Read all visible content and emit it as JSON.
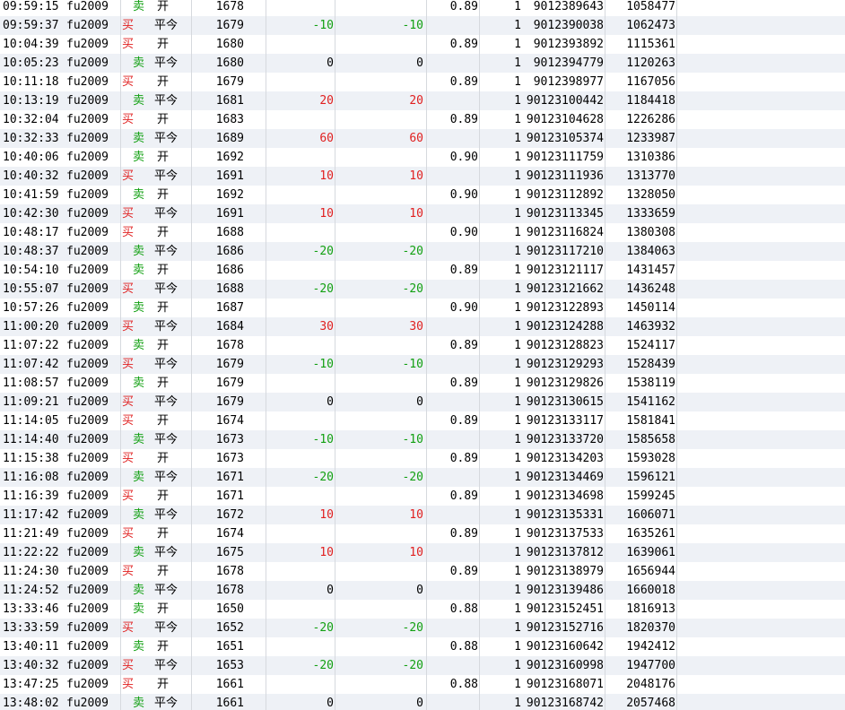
{
  "colors": {
    "buy": "#e02020",
    "sell": "#12a012",
    "row_alt_bg": "#eef1f6",
    "grid_line": "#d6d9de"
  },
  "rows": [
    {
      "time": "09:59:15",
      "code": "fu2009",
      "dir": "卖",
      "oc": "开",
      "price": "1678",
      "pnl1": "",
      "pnl2": "",
      "fee": "0.89",
      "qty": "1",
      "order_no": "9012389643",
      "trade_no": "1058477"
    },
    {
      "time": "09:59:37",
      "code": "fu2009",
      "dir": "买",
      "oc": "平今",
      "price": "1679",
      "pnl1": "-10",
      "pnl2": "-10",
      "fee": "",
      "qty": "1",
      "order_no": "9012390038",
      "trade_no": "1062473"
    },
    {
      "time": "10:04:39",
      "code": "fu2009",
      "dir": "买",
      "oc": "开",
      "price": "1680",
      "pnl1": "",
      "pnl2": "",
      "fee": "0.89",
      "qty": "1",
      "order_no": "9012393892",
      "trade_no": "1115361"
    },
    {
      "time": "10:05:23",
      "code": "fu2009",
      "dir": "卖",
      "oc": "平今",
      "price": "1680",
      "pnl1": "0",
      "pnl2": "0",
      "fee": "",
      "qty": "1",
      "order_no": "9012394779",
      "trade_no": "1120263"
    },
    {
      "time": "10:11:18",
      "code": "fu2009",
      "dir": "买",
      "oc": "开",
      "price": "1679",
      "pnl1": "",
      "pnl2": "",
      "fee": "0.89",
      "qty": "1",
      "order_no": "9012398977",
      "trade_no": "1167056"
    },
    {
      "time": "10:13:19",
      "code": "fu2009",
      "dir": "卖",
      "oc": "平今",
      "price": "1681",
      "pnl1": "20",
      "pnl2": "20",
      "fee": "",
      "qty": "1",
      "order_no": "90123100442",
      "trade_no": "1184418"
    },
    {
      "time": "10:32:04",
      "code": "fu2009",
      "dir": "买",
      "oc": "开",
      "price": "1683",
      "pnl1": "",
      "pnl2": "",
      "fee": "0.89",
      "qty": "1",
      "order_no": "90123104628",
      "trade_no": "1226286"
    },
    {
      "time": "10:32:33",
      "code": "fu2009",
      "dir": "卖",
      "oc": "平今",
      "price": "1689",
      "pnl1": "60",
      "pnl2": "60",
      "fee": "",
      "qty": "1",
      "order_no": "90123105374",
      "trade_no": "1233987"
    },
    {
      "time": "10:40:06",
      "code": "fu2009",
      "dir": "卖",
      "oc": "开",
      "price": "1692",
      "pnl1": "",
      "pnl2": "",
      "fee": "0.90",
      "qty": "1",
      "order_no": "90123111759",
      "trade_no": "1310386"
    },
    {
      "time": "10:40:32",
      "code": "fu2009",
      "dir": "买",
      "oc": "平今",
      "price": "1691",
      "pnl1": "10",
      "pnl2": "10",
      "fee": "",
      "qty": "1",
      "order_no": "90123111936",
      "trade_no": "1313770"
    },
    {
      "time": "10:41:59",
      "code": "fu2009",
      "dir": "卖",
      "oc": "开",
      "price": "1692",
      "pnl1": "",
      "pnl2": "",
      "fee": "0.90",
      "qty": "1",
      "order_no": "90123112892",
      "trade_no": "1328050"
    },
    {
      "time": "10:42:30",
      "code": "fu2009",
      "dir": "买",
      "oc": "平今",
      "price": "1691",
      "pnl1": "10",
      "pnl2": "10",
      "fee": "",
      "qty": "1",
      "order_no": "90123113345",
      "trade_no": "1333659"
    },
    {
      "time": "10:48:17",
      "code": "fu2009",
      "dir": "买",
      "oc": "开",
      "price": "1688",
      "pnl1": "",
      "pnl2": "",
      "fee": "0.90",
      "qty": "1",
      "order_no": "90123116824",
      "trade_no": "1380308"
    },
    {
      "time": "10:48:37",
      "code": "fu2009",
      "dir": "卖",
      "oc": "平今",
      "price": "1686",
      "pnl1": "-20",
      "pnl2": "-20",
      "fee": "",
      "qty": "1",
      "order_no": "90123117210",
      "trade_no": "1384063"
    },
    {
      "time": "10:54:10",
      "code": "fu2009",
      "dir": "卖",
      "oc": "开",
      "price": "1686",
      "pnl1": "",
      "pnl2": "",
      "fee": "0.89",
      "qty": "1",
      "order_no": "90123121117",
      "trade_no": "1431457"
    },
    {
      "time": "10:55:07",
      "code": "fu2009",
      "dir": "买",
      "oc": "平今",
      "price": "1688",
      "pnl1": "-20",
      "pnl2": "-20",
      "fee": "",
      "qty": "1",
      "order_no": "90123121662",
      "trade_no": "1436248"
    },
    {
      "time": "10:57:26",
      "code": "fu2009",
      "dir": "卖",
      "oc": "开",
      "price": "1687",
      "pnl1": "",
      "pnl2": "",
      "fee": "0.90",
      "qty": "1",
      "order_no": "90123122893",
      "trade_no": "1450114"
    },
    {
      "time": "11:00:20",
      "code": "fu2009",
      "dir": "买",
      "oc": "平今",
      "price": "1684",
      "pnl1": "30",
      "pnl2": "30",
      "fee": "",
      "qty": "1",
      "order_no": "90123124288",
      "trade_no": "1463932"
    },
    {
      "time": "11:07:22",
      "code": "fu2009",
      "dir": "卖",
      "oc": "开",
      "price": "1678",
      "pnl1": "",
      "pnl2": "",
      "fee": "0.89",
      "qty": "1",
      "order_no": "90123128823",
      "trade_no": "1524117"
    },
    {
      "time": "11:07:42",
      "code": "fu2009",
      "dir": "买",
      "oc": "平今",
      "price": "1679",
      "pnl1": "-10",
      "pnl2": "-10",
      "fee": "",
      "qty": "1",
      "order_no": "90123129293",
      "trade_no": "1528439"
    },
    {
      "time": "11:08:57",
      "code": "fu2009",
      "dir": "卖",
      "oc": "开",
      "price": "1679",
      "pnl1": "",
      "pnl2": "",
      "fee": "0.89",
      "qty": "1",
      "order_no": "90123129826",
      "trade_no": "1538119"
    },
    {
      "time": "11:09:21",
      "code": "fu2009",
      "dir": "买",
      "oc": "平今",
      "price": "1679",
      "pnl1": "0",
      "pnl2": "0",
      "fee": "",
      "qty": "1",
      "order_no": "90123130615",
      "trade_no": "1541162"
    },
    {
      "time": "11:14:05",
      "code": "fu2009",
      "dir": "买",
      "oc": "开",
      "price": "1674",
      "pnl1": "",
      "pnl2": "",
      "fee": "0.89",
      "qty": "1",
      "order_no": "90123133117",
      "trade_no": "1581841"
    },
    {
      "time": "11:14:40",
      "code": "fu2009",
      "dir": "卖",
      "oc": "平今",
      "price": "1673",
      "pnl1": "-10",
      "pnl2": "-10",
      "fee": "",
      "qty": "1",
      "order_no": "90123133720",
      "trade_no": "1585658"
    },
    {
      "time": "11:15:38",
      "code": "fu2009",
      "dir": "买",
      "oc": "开",
      "price": "1673",
      "pnl1": "",
      "pnl2": "",
      "fee": "0.89",
      "qty": "1",
      "order_no": "90123134203",
      "trade_no": "1593028"
    },
    {
      "time": "11:16:08",
      "code": "fu2009",
      "dir": "卖",
      "oc": "平今",
      "price": "1671",
      "pnl1": "-20",
      "pnl2": "-20",
      "fee": "",
      "qty": "1",
      "order_no": "90123134469",
      "trade_no": "1596121"
    },
    {
      "time": "11:16:39",
      "code": "fu2009",
      "dir": "买",
      "oc": "开",
      "price": "1671",
      "pnl1": "",
      "pnl2": "",
      "fee": "0.89",
      "qty": "1",
      "order_no": "90123134698",
      "trade_no": "1599245"
    },
    {
      "time": "11:17:42",
      "code": "fu2009",
      "dir": "卖",
      "oc": "平今",
      "price": "1672",
      "pnl1": "10",
      "pnl2": "10",
      "fee": "",
      "qty": "1",
      "order_no": "90123135331",
      "trade_no": "1606071"
    },
    {
      "time": "11:21:49",
      "code": "fu2009",
      "dir": "买",
      "oc": "开",
      "price": "1674",
      "pnl1": "",
      "pnl2": "",
      "fee": "0.89",
      "qty": "1",
      "order_no": "90123137533",
      "trade_no": "1635261"
    },
    {
      "time": "11:22:22",
      "code": "fu2009",
      "dir": "卖",
      "oc": "平今",
      "price": "1675",
      "pnl1": "10",
      "pnl2": "10",
      "fee": "",
      "qty": "1",
      "order_no": "90123137812",
      "trade_no": "1639061"
    },
    {
      "time": "11:24:30",
      "code": "fu2009",
      "dir": "买",
      "oc": "开",
      "price": "1678",
      "pnl1": "",
      "pnl2": "",
      "fee": "0.89",
      "qty": "1",
      "order_no": "90123138979",
      "trade_no": "1656944"
    },
    {
      "time": "11:24:52",
      "code": "fu2009",
      "dir": "卖",
      "oc": "平今",
      "price": "1678",
      "pnl1": "0",
      "pnl2": "0",
      "fee": "",
      "qty": "1",
      "order_no": "90123139486",
      "trade_no": "1660018"
    },
    {
      "time": "13:33:46",
      "code": "fu2009",
      "dir": "卖",
      "oc": "开",
      "price": "1650",
      "pnl1": "",
      "pnl2": "",
      "fee": "0.88",
      "qty": "1",
      "order_no": "90123152451",
      "trade_no": "1816913"
    },
    {
      "time": "13:33:59",
      "code": "fu2009",
      "dir": "买",
      "oc": "平今",
      "price": "1652",
      "pnl1": "-20",
      "pnl2": "-20",
      "fee": "",
      "qty": "1",
      "order_no": "90123152716",
      "trade_no": "1820370"
    },
    {
      "time": "13:40:11",
      "code": "fu2009",
      "dir": "卖",
      "oc": "开",
      "price": "1651",
      "pnl1": "",
      "pnl2": "",
      "fee": "0.88",
      "qty": "1",
      "order_no": "90123160642",
      "trade_no": "1942412"
    },
    {
      "time": "13:40:32",
      "code": "fu2009",
      "dir": "买",
      "oc": "平今",
      "price": "1653",
      "pnl1": "-20",
      "pnl2": "-20",
      "fee": "",
      "qty": "1",
      "order_no": "90123160998",
      "trade_no": "1947700"
    },
    {
      "time": "13:47:25",
      "code": "fu2009",
      "dir": "买",
      "oc": "开",
      "price": "1661",
      "pnl1": "",
      "pnl2": "",
      "fee": "0.88",
      "qty": "1",
      "order_no": "90123168071",
      "trade_no": "2048176"
    },
    {
      "time": "13:48:02",
      "code": "fu2009",
      "dir": "卖",
      "oc": "平今",
      "price": "1661",
      "pnl1": "0",
      "pnl2": "0",
      "fee": "",
      "qty": "1",
      "order_no": "90123168742",
      "trade_no": "2057468"
    }
  ]
}
